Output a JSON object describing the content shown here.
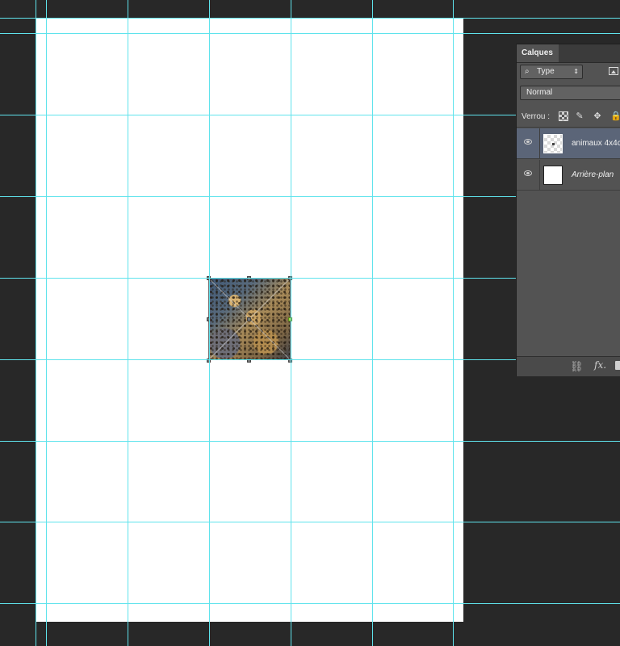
{
  "layers_panel": {
    "tab_label": "Calques",
    "filter": {
      "kind_label": "Type",
      "search_glyph": "⌕",
      "arrows": "⇕",
      "image_icon": "image-filter-icon"
    },
    "blend_mode": "Normal",
    "lock": {
      "label": "Verrou :",
      "icons": [
        "lock-transparent-icon",
        "lock-paint-icon",
        "lock-position-icon",
        "lock-all-icon"
      ]
    },
    "layers": [
      {
        "name": "animaux 4x4c",
        "selected": true,
        "visible": true,
        "thumbnail": "transparent"
      },
      {
        "name": "Arrière-plan",
        "selected": false,
        "visible": true,
        "thumbnail": "white",
        "italic": true
      }
    ],
    "footer": {
      "link_glyph": "⛓",
      "fx_label": "fx."
    }
  },
  "colors": {
    "workspace": "#282828",
    "guide": "#5fe3ec",
    "panel": "#535353",
    "selected_layer": "#5b6578"
  }
}
